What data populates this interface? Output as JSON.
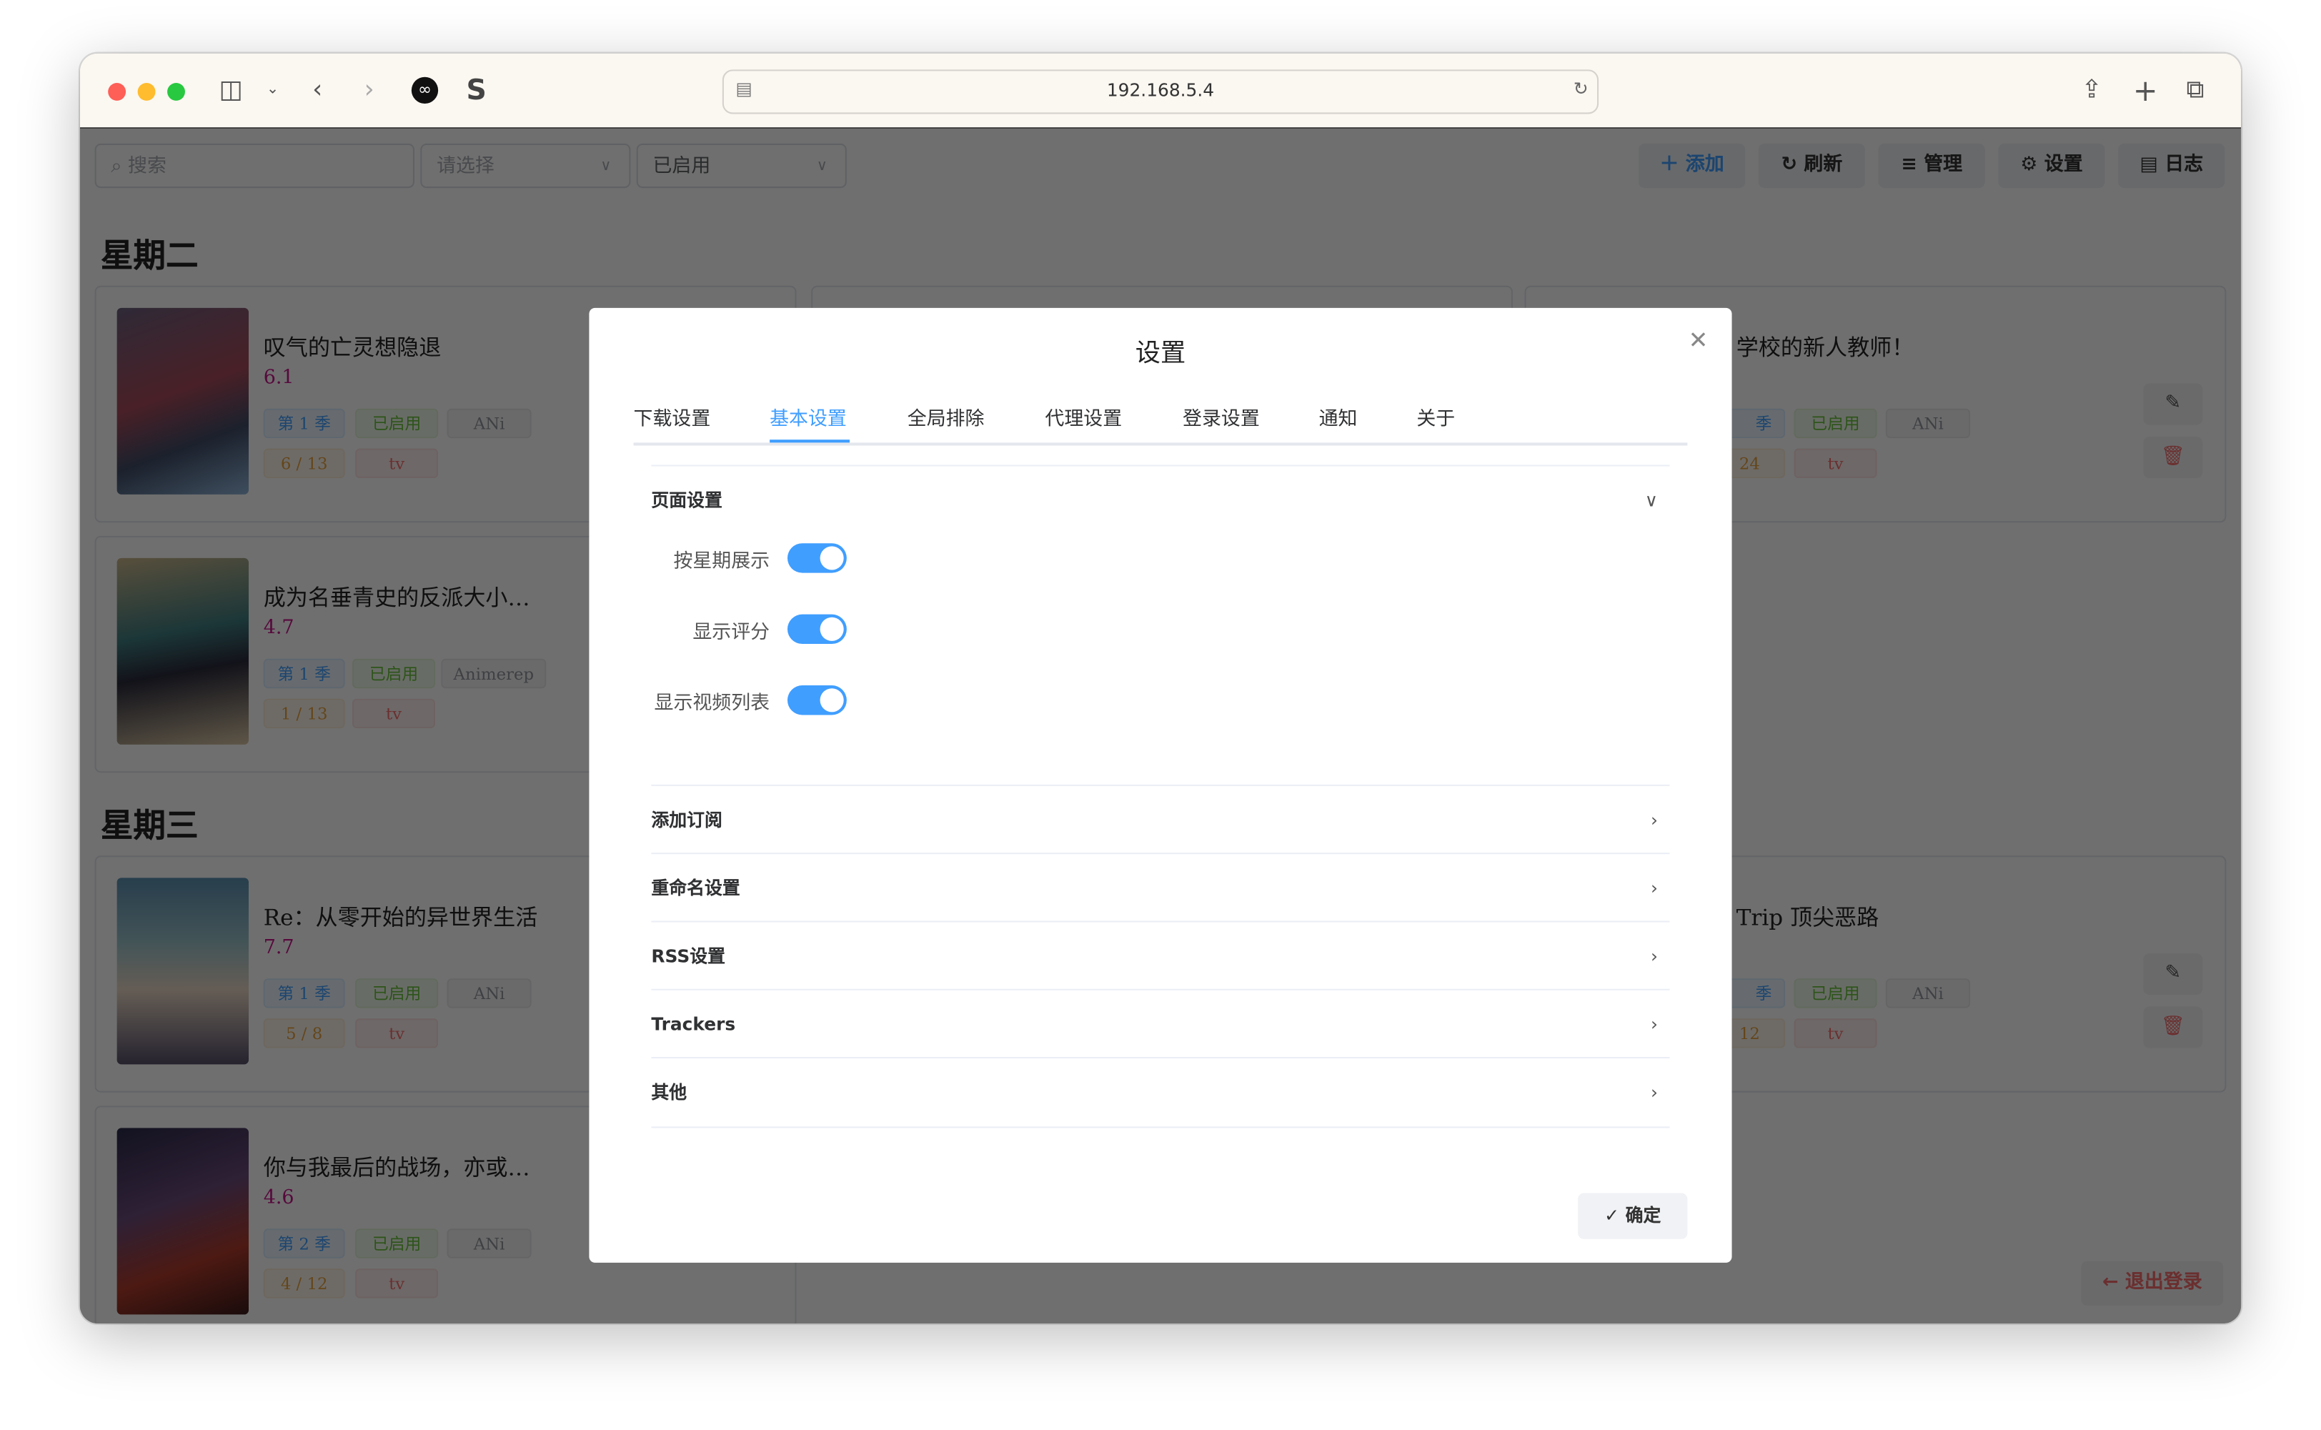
{
  "browser": {
    "url": "192.168.5.4"
  },
  "toolbar": {
    "search_placeholder": "搜索",
    "select_placeholder": "请选择",
    "status_select": "已启用",
    "add": "添加",
    "refresh": "刷新",
    "manage": "管理",
    "settings": "设置",
    "log": "日志"
  },
  "days": [
    "星期二",
    "星期三"
  ],
  "cards": [
    {
      "title": "叹气的亡灵想隐退",
      "score": "6.1",
      "season": "第 1 季",
      "status": "已启用",
      "group": "ANi",
      "progress": "6 / 13",
      "type": "tv"
    },
    {
      "title": "成为名垂青史的反派大小…",
      "score": "4.7",
      "season": "第 1 季",
      "status": "已启用",
      "group": "Animerep",
      "progress": "1 / 13",
      "type": "tv"
    },
    {
      "title": "Re：从零开始的异世界生活",
      "score": "7.7",
      "season": "第 1 季",
      "status": "已启用",
      "group": "ANi",
      "progress": "5 / 8",
      "type": "tv"
    },
    {
      "title": "你与我最后的战场，亦或…",
      "score": "4.6",
      "season": "第 2 季",
      "status": "已启用",
      "group": "ANi",
      "progress": "4 / 12",
      "type": "tv"
    }
  ],
  "right_cards": [
    {
      "title": "学校的新人教师！",
      "season": "季",
      "status": "已启用",
      "group": "ANi",
      "progress": "24",
      "type": "tv"
    },
    {
      "title": "Trip 顶尖恶路",
      "season": "季",
      "status": "已启用",
      "group": "ANi",
      "progress": "12",
      "type": "tv"
    }
  ],
  "logout": "退出登录",
  "dialog": {
    "title": "设置",
    "tabs": [
      "下载设置",
      "基本设置",
      "全局排除",
      "代理设置",
      "登录设置",
      "通知",
      "关于"
    ],
    "active_tab": "基本设置",
    "page_section": "页面设置",
    "toggles": [
      {
        "label": "按星期展示",
        "on": true
      },
      {
        "label": "显示评分",
        "on": true
      },
      {
        "label": "显示视频列表",
        "on": true
      }
    ],
    "sections": [
      "添加订阅",
      "重命名设置",
      "RSS设置",
      "Trackers",
      "其他"
    ],
    "confirm": "确定"
  }
}
